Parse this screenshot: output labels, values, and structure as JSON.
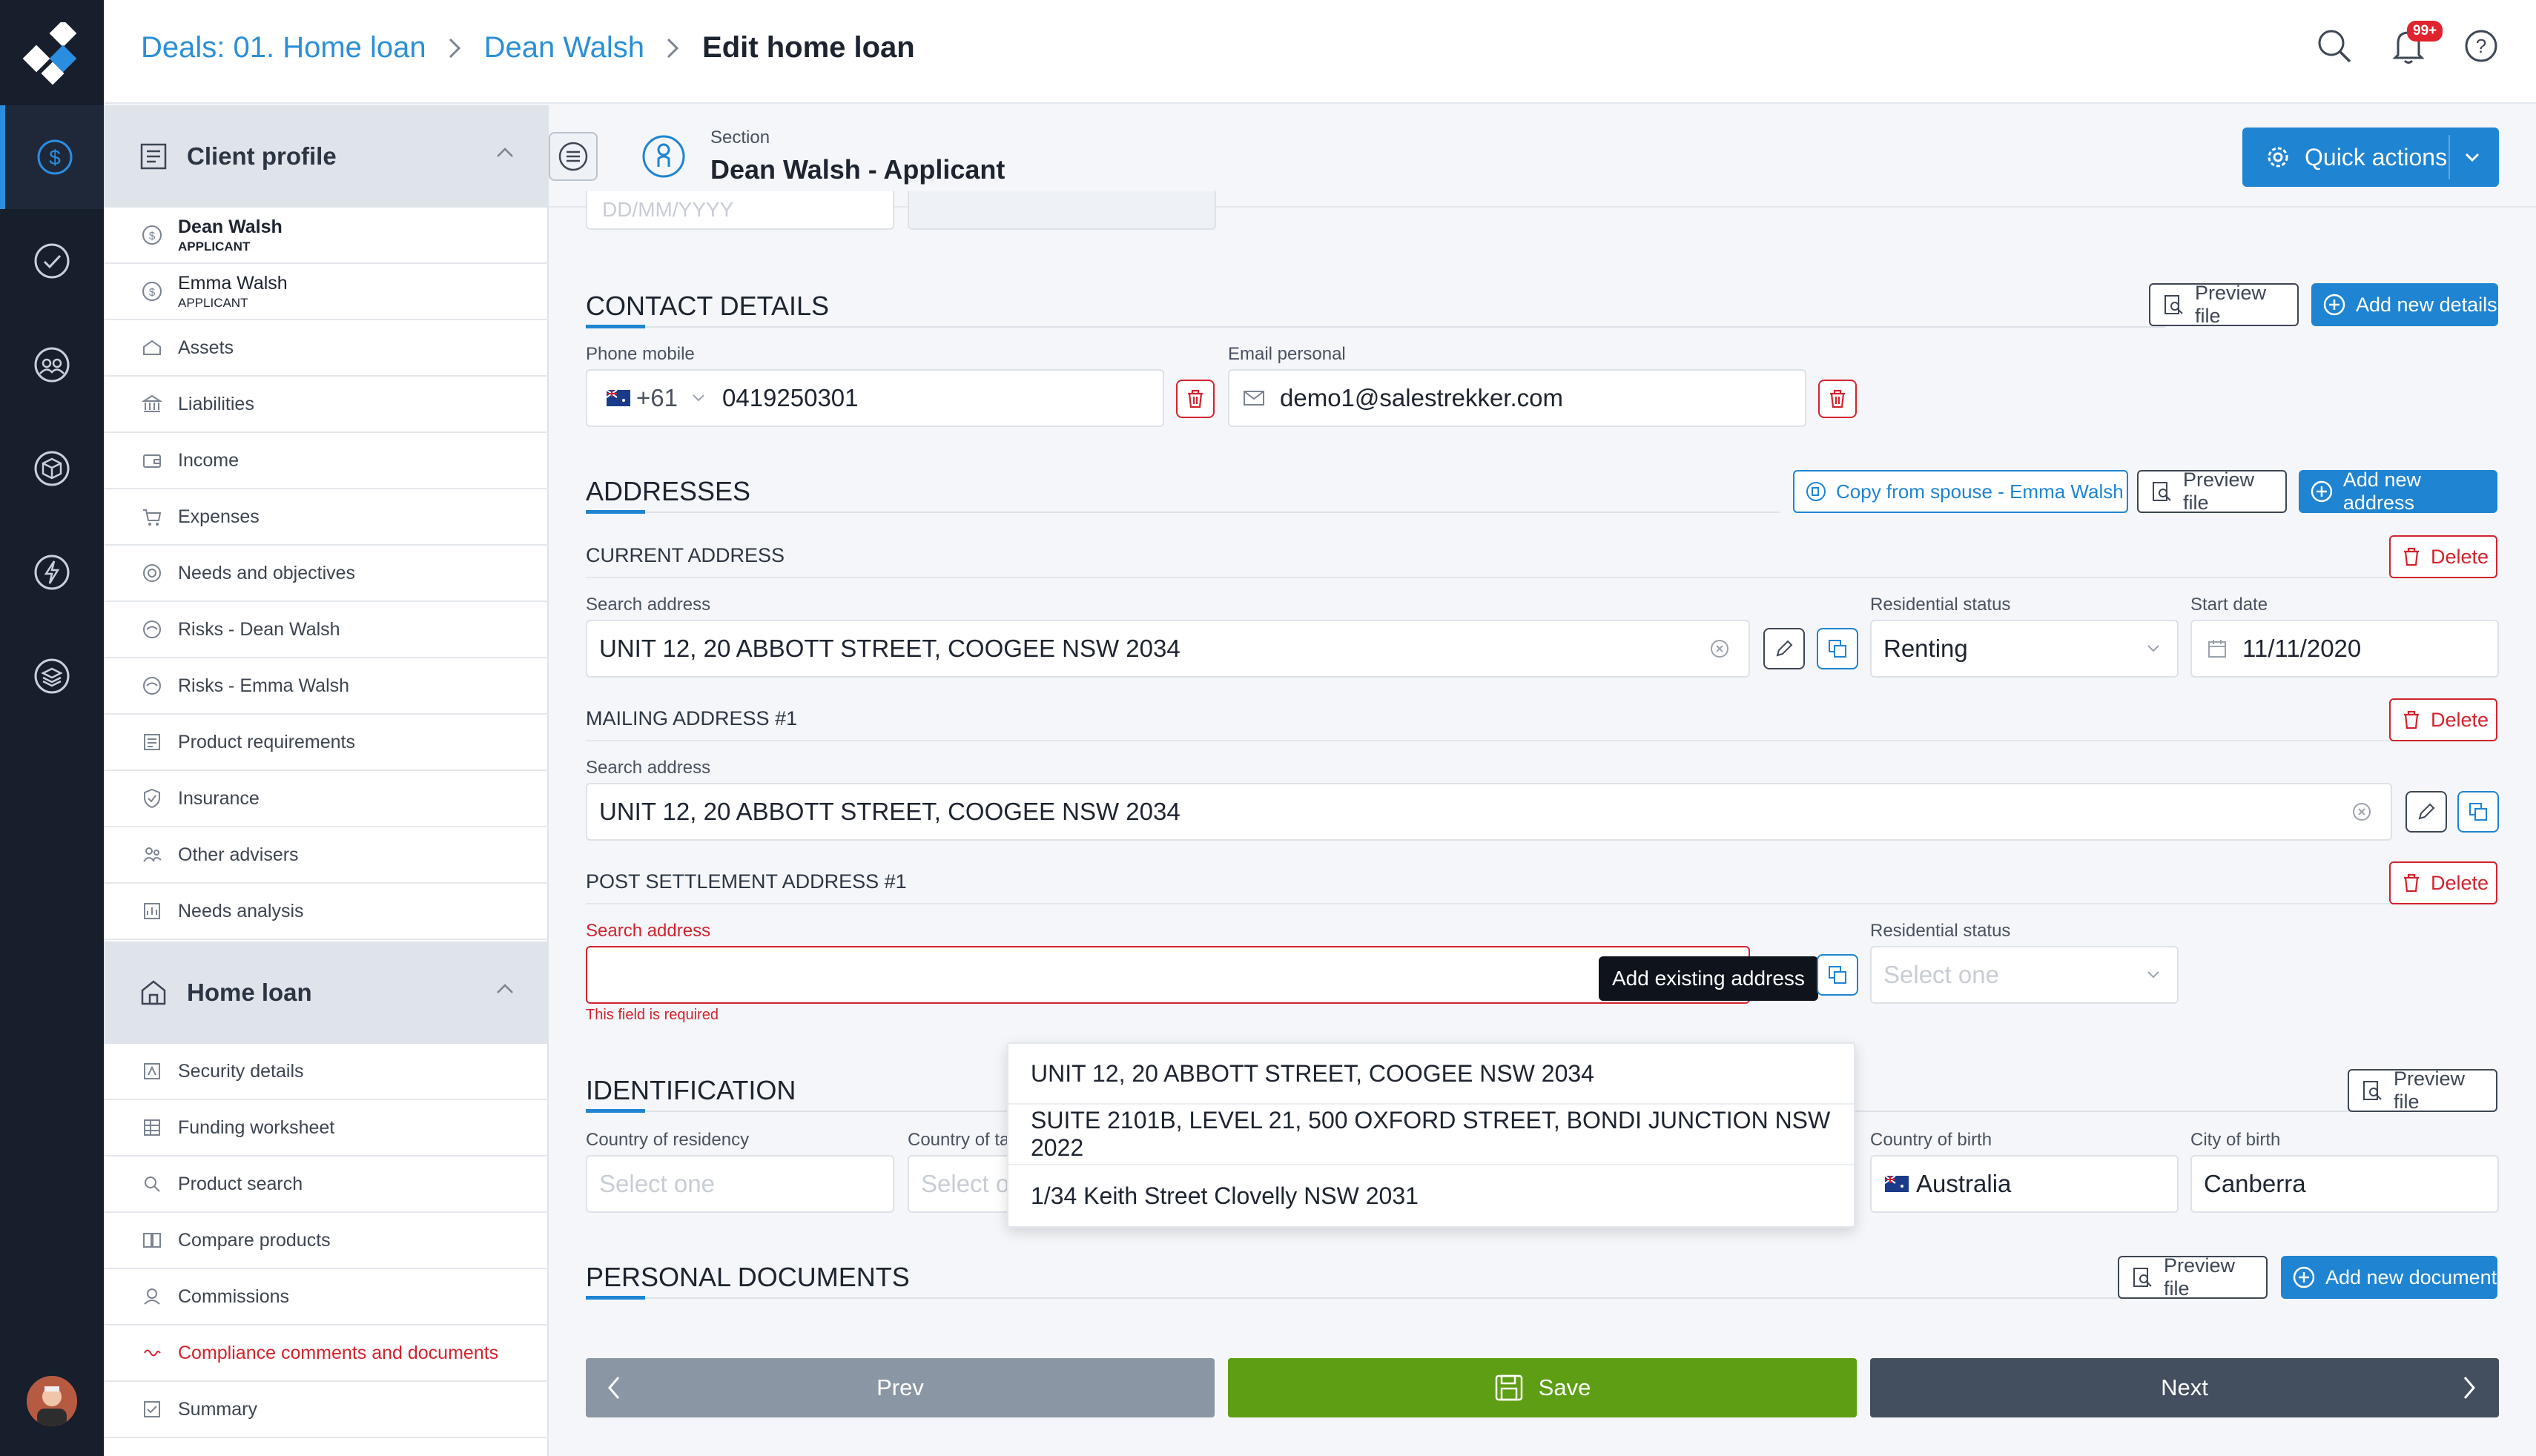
{
  "breadcrumb": {
    "deal": "Deals: 01. Home loan",
    "client": "Dean Walsh",
    "current": "Edit home loan"
  },
  "notifications": {
    "badge": "99+"
  },
  "section": {
    "label": "Section",
    "title": "Dean Walsh - Applicant",
    "quick_actions": "Quick actions"
  },
  "sidebar": {
    "client_profile": "Client profile",
    "client_items": [
      {
        "name": "Dean Walsh",
        "sub": "APPLICANT",
        "icon": "dollar-circle-icon"
      },
      {
        "name": "Emma Walsh",
        "sub": "APPLICANT",
        "icon": "dollar-circle-icon"
      },
      {
        "label": "Assets",
        "icon": "assets-icon"
      },
      {
        "label": "Liabilities",
        "icon": "bank-icon"
      },
      {
        "label": "Income",
        "icon": "wallet-icon"
      },
      {
        "label": "Expenses",
        "icon": "cart-icon"
      },
      {
        "label": "Needs and objectives",
        "icon": "target-icon"
      },
      {
        "label": "Risks - Dean Walsh",
        "icon": "risk-icon"
      },
      {
        "label": "Risks - Emma Walsh",
        "icon": "risk-icon"
      },
      {
        "label": "Product requirements",
        "icon": "product-icon"
      },
      {
        "label": "Insurance",
        "icon": "shield-icon"
      },
      {
        "label": "Other advisers",
        "icon": "users-icon"
      },
      {
        "label": "Needs analysis",
        "icon": "analysis-icon"
      }
    ],
    "home_loan": "Home loan",
    "loan_items": [
      {
        "label": "Security details",
        "icon": "security-icon"
      },
      {
        "label": "Funding worksheet",
        "icon": "worksheet-icon"
      },
      {
        "label": "Product search",
        "icon": "search-doc-icon"
      },
      {
        "label": "Compare products",
        "icon": "compare-icon"
      },
      {
        "label": "Commissions",
        "icon": "commission-icon"
      },
      {
        "label": "Compliance comments and documents",
        "icon": "compliance-icon"
      },
      {
        "label": "Summary",
        "icon": "summary-icon"
      }
    ]
  },
  "top_partial": {
    "dob_placeholder": "DD/MM/YYYY"
  },
  "contact": {
    "title": "CONTACT DETAILS",
    "preview": "Preview file",
    "add": "Add new details",
    "phone_label": "Phone mobile",
    "phone_code": "+61",
    "phone_value": "0419250301",
    "email_label": "Email personal",
    "email_value": "demo1@salestrekker.com"
  },
  "addresses": {
    "title": "ADDRESSES",
    "copy": "Copy from spouse - Emma Walsh",
    "preview": "Preview file",
    "add": "Add new address",
    "delete": "Delete",
    "current": {
      "title": "CURRENT ADDRESS",
      "search_label": "Search address",
      "search_value": "UNIT 12, 20 ABBOTT STREET, COOGEE NSW 2034",
      "res_label": "Residential status",
      "res_value": "Renting",
      "start_label": "Start date",
      "start_value": "11/11/2020"
    },
    "mailing": {
      "title": "MAILING ADDRESS #1",
      "search_label": "Search address",
      "search_value": "UNIT 12, 20 ABBOTT STREET, COOGEE NSW 2034"
    },
    "post": {
      "title": "POST SETTLEMENT ADDRESS #1",
      "search_label": "Search address",
      "error": "This field is required",
      "res_label": "Residential status",
      "res_placeholder": "Select one",
      "tooltip": "Add existing address"
    },
    "suggestions": [
      "UNIT 12, 20 ABBOTT STREET, COOGEE NSW 2034",
      "SUITE 2101B, LEVEL 21, 500 OXFORD STREET, BONDI JUNCTION NSW 2022",
      "1/34 Keith Street Clovelly NSW 2031"
    ]
  },
  "identification": {
    "title": "IDENTIFICATION",
    "preview": "Preview file",
    "residency_label": "Country of residency",
    "residency_placeholder": "Select one",
    "tax_label": "Country of ta",
    "tax_placeholder": "Select o",
    "birth_country_label": "Country of birth",
    "birth_country_value": "Australia",
    "birth_city_label": "City of birth",
    "birth_city_value": "Canberra"
  },
  "documents": {
    "title": "PERSONAL DOCUMENTS",
    "preview": "Preview file",
    "add": "Add new document"
  },
  "footer": {
    "prev": "Prev",
    "save": "Save",
    "next": "Next"
  },
  "colors": {
    "primary": "#1f84d1",
    "danger": "#d2232e",
    "save": "#5e9e14",
    "rail": "#171e2c"
  }
}
